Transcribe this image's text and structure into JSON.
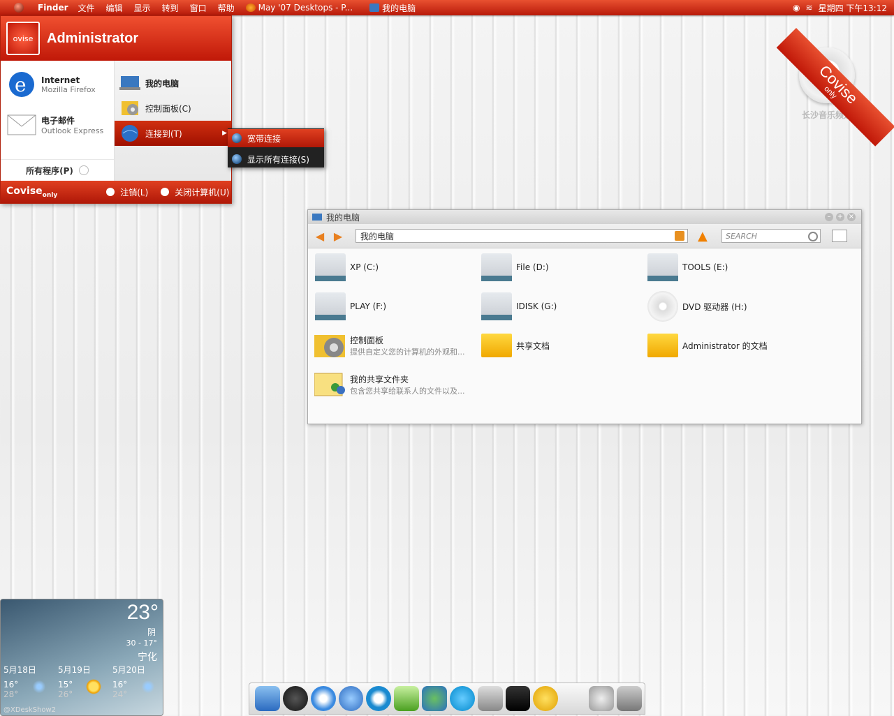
{
  "menubar": {
    "items": [
      "Finder",
      "文件",
      "编辑",
      "显示",
      "转到",
      "窗口",
      "帮助"
    ],
    "tasks": [
      {
        "label": "May '07 Desktops - P...",
        "icon": "firefox-icon"
      },
      {
        "label": "我的电脑",
        "icon": "computer-icon"
      }
    ],
    "clock": "星期四 下午13:12"
  },
  "start_menu": {
    "user": "Administrator",
    "logo": "ovise",
    "pinned": [
      {
        "title": "Internet",
        "subtitle": "Mozilla Firefox",
        "icon": "ie-icon"
      },
      {
        "title": "电子邮件",
        "subtitle": "Outlook Express",
        "icon": "mail-icon"
      }
    ],
    "all_programs": "所有程序(P)",
    "right_items": [
      {
        "label": "我的电脑",
        "icon": "computer-icon"
      },
      {
        "label": "控制面板(C)",
        "icon": "gear-icon"
      },
      {
        "label": "连接到(T)",
        "icon": "globe-icon"
      }
    ],
    "footer": {
      "brand": "Covise",
      "brand_sub": "only",
      "logoff": "注销(L)",
      "shutdown": "关闭计算机(U)"
    }
  },
  "submenu": {
    "items": [
      "宽带连接",
      "显示所有连接(S)"
    ]
  },
  "explorer": {
    "title": "我的电脑",
    "address": "我的电脑",
    "search_placeholder": "SEARCH",
    "items": [
      {
        "name": "XP (C:)",
        "type": "drive"
      },
      {
        "name": "File (D:)",
        "type": "drive"
      },
      {
        "name": "TOOLS (E:)",
        "type": "drive"
      },
      {
        "name": "PLAY (F:)",
        "type": "drive"
      },
      {
        "name": "IDISK (G:)",
        "type": "drive"
      },
      {
        "name": "DVD 驱动器 (H:)",
        "type": "cd"
      },
      {
        "name": "控制面板",
        "desc": "提供自定义您的计算机的外观和...",
        "type": "gear"
      },
      {
        "name": "共享文档",
        "type": "folder"
      },
      {
        "name": "Administrator 的文档",
        "type": "folder"
      },
      {
        "name": "我的共享文件夹",
        "desc": "包含您共享给联系人的文件以及...",
        "type": "sharefolder"
      }
    ]
  },
  "weather": {
    "temp": "23°",
    "condition": "阴",
    "range": "30 - 17°",
    "city": "宁化",
    "days": [
      {
        "date": "5月18日",
        "hi": "16°",
        "lo": "28°",
        "icon": "rain-icon"
      },
      {
        "date": "5月19日",
        "hi": "15°",
        "lo": "26°",
        "icon": "sun-icon"
      },
      {
        "date": "5月20日",
        "hi": "16°",
        "lo": "24°",
        "icon": "rain-icon"
      }
    ],
    "credit": "@XDeskShow2"
  },
  "widget": {
    "label": "长沙音乐频道",
    "ribbon_text": "Covise",
    "ribbon_sub": "only"
  },
  "colors": {
    "accent": "#d02810",
    "window_bg": "#fafafa"
  }
}
